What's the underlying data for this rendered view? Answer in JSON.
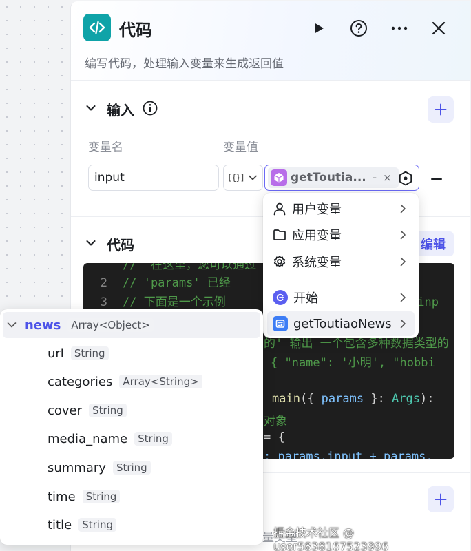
{
  "panel": {
    "title": "代码",
    "description": "编写代码，处理输入变量来生成返回值",
    "node_icon": "code-icon",
    "actions": [
      "run-icon",
      "help-icon",
      "more-icon",
      "close-icon"
    ]
  },
  "input_section": {
    "title": "输入",
    "info_icon": "info-icon",
    "col_name": "变量名",
    "col_value": "变量值",
    "variable": {
      "name": "input",
      "type_glyph": "[{}]",
      "ref_label": "getToutia...",
      "ref_dash": "-",
      "ref_close": "×"
    }
  },
  "code_section": {
    "title": "代码",
    "edit_label": "编辑",
    "lines": [
      {
        "num": "2",
        "text": "// 'params' 已经"
      },
      {
        "num": "3",
        "text": "// 下面是一个示例"
      }
    ],
    "partials": {
      "top": "//  在这里，您可以通过 'params'",
      "line3_tail": "为'inp",
      "line5": "的' 输出 一个包含多种数据类型的",
      "line6a": "{ \"name\": '小明', \"hobbi",
      "line8_fn": "main",
      "line8_open": "({ ",
      "line8_params": "params",
      "line8_mid": " }: ",
      "line8_type": "Args",
      "line8_close": "):",
      "line9": "对象",
      "line10": "= {",
      "line11": ": params.input + params."
    }
  },
  "output_section": {
    "add_icon": "plus-icon",
    "ghost": "量类型"
  },
  "variable_menu": {
    "items": [
      {
        "label": "用户变量",
        "icon": "user-icon"
      },
      {
        "label": "应用变量",
        "icon": "folder-icon"
      },
      {
        "label": "系统变量",
        "icon": "gear-icon"
      },
      {
        "label": "开始",
        "icon": "start-node-icon"
      },
      {
        "label": "getToutiaoNews",
        "icon": "news-node-icon"
      }
    ]
  },
  "output_tree": {
    "root": {
      "name": "news",
      "type": "Array<Object>"
    },
    "fields": [
      {
        "name": "url",
        "type": "String"
      },
      {
        "name": "categories",
        "type": "Array<String>"
      },
      {
        "name": "cover",
        "type": "String"
      },
      {
        "name": "media_name",
        "type": "String"
      },
      {
        "name": "summary",
        "type": "String"
      },
      {
        "name": "time",
        "type": "String"
      },
      {
        "name": "title",
        "type": "String"
      }
    ]
  },
  "watermark": "掘金技术社区 @ user5838167523996"
}
